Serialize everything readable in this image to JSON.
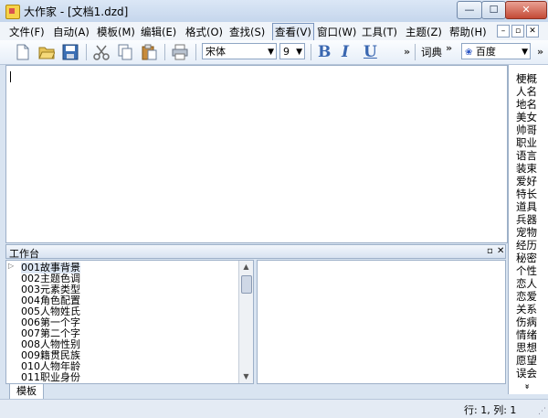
{
  "window": {
    "title": "大作家 - [文档1.dzd]",
    "buttons": {
      "minimize": "—",
      "maximize": "☐",
      "close": "✕"
    }
  },
  "menu": {
    "items": [
      "文件(F)",
      "自动(A)",
      "模板(M)",
      "编辑(E)",
      "格式(O)",
      "查找(S)",
      "查看(V)",
      "窗口(W)",
      "工具(T)",
      "主题(Z)",
      "帮助(H)"
    ],
    "mdi_controls": [
      "–",
      "▫",
      "✕"
    ]
  },
  "toolbar": {
    "font_name": "宋体",
    "font_size": "9",
    "bold": "B",
    "italic": "I",
    "underline": "U",
    "overflow": "»",
    "dictionary": "词典",
    "search_engine": "百度",
    "colors": {
      "accent": "#3966b0"
    }
  },
  "right_panel": {
    "tags": [
      "梗概",
      "人名",
      "地名",
      "美女",
      "帅哥",
      "职业",
      "语言",
      "装束",
      "爱好",
      "特长",
      "道具",
      "兵器",
      "宠物",
      "经历",
      "秘密",
      "个性",
      "恋人",
      "恋爱",
      "关系",
      "伤病",
      "情绪",
      "思想",
      "愿望",
      "误会"
    ],
    "more": "»"
  },
  "workspace": {
    "title": "工作台",
    "items": [
      "001故事背景",
      "002主题色调",
      "003元素类型",
      "004角色配置",
      "005人物姓氏",
      "006第一个字",
      "007第二个字",
      "008人物性别",
      "009籍贯民族",
      "010人物年龄",
      "011职业身份"
    ]
  },
  "bottom_tab": "模板",
  "status": {
    "position": "行: 1,  列: 1"
  }
}
